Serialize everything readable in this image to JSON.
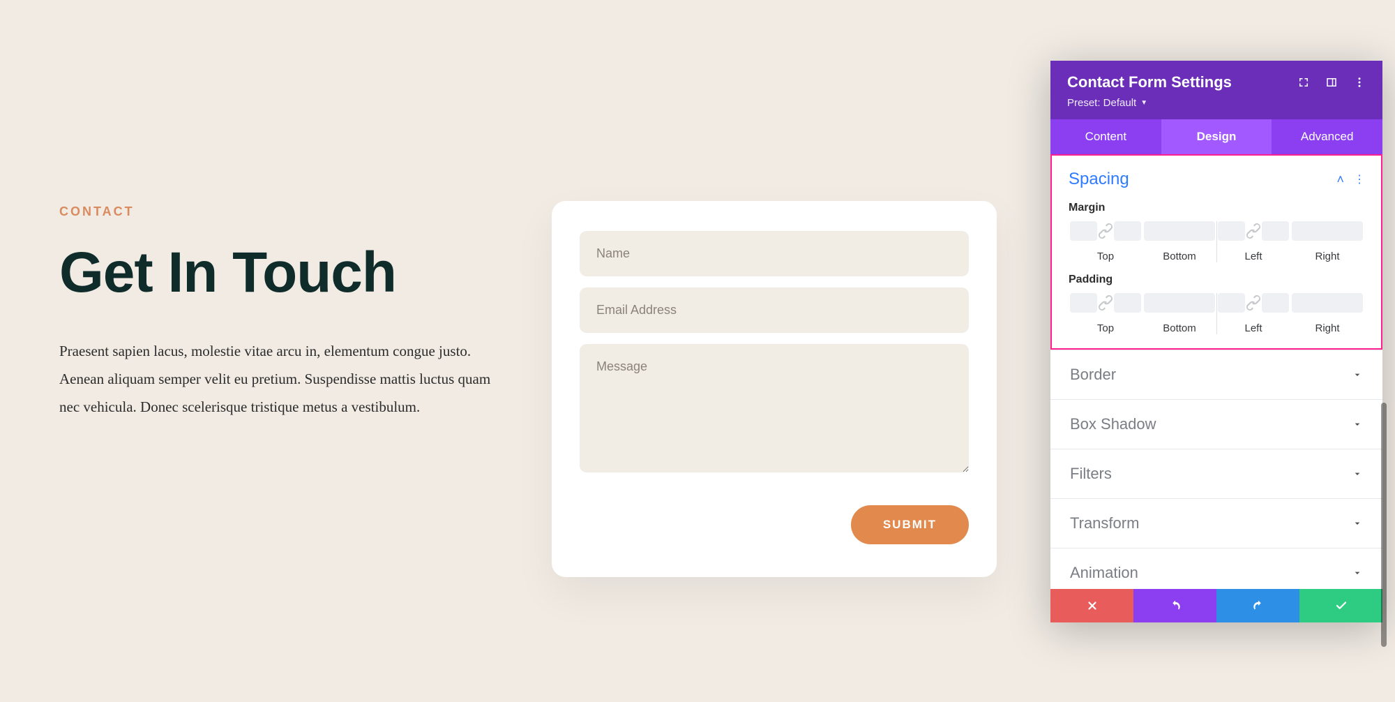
{
  "intro": {
    "eyebrow": "CONTACT",
    "title": "Get In Touch",
    "body": "Praesent sapien lacus, molestie vitae arcu in, elementum congue justo. Aenean aliquam semper velit eu pretium. Suspendisse mattis luctus quam nec vehicula. Donec scelerisque tristique metus a vestibulum."
  },
  "form": {
    "name_placeholder": "Name",
    "email_placeholder": "Email Address",
    "message_placeholder": "Message",
    "submit_label": "SUBMIT"
  },
  "panel": {
    "title": "Contact Form Settings",
    "preset": "Preset: Default",
    "tabs": {
      "content": "Content",
      "design": "Design",
      "advanced": "Advanced"
    },
    "spacing": {
      "title": "Spacing",
      "margin_label": "Margin",
      "padding_label": "Padding",
      "cols": {
        "top": "Top",
        "bottom": "Bottom",
        "left": "Left",
        "right": "Right"
      }
    },
    "rows": {
      "border": "Border",
      "box_shadow": "Box Shadow",
      "filters": "Filters",
      "transform": "Transform",
      "animation": "Animation"
    }
  }
}
